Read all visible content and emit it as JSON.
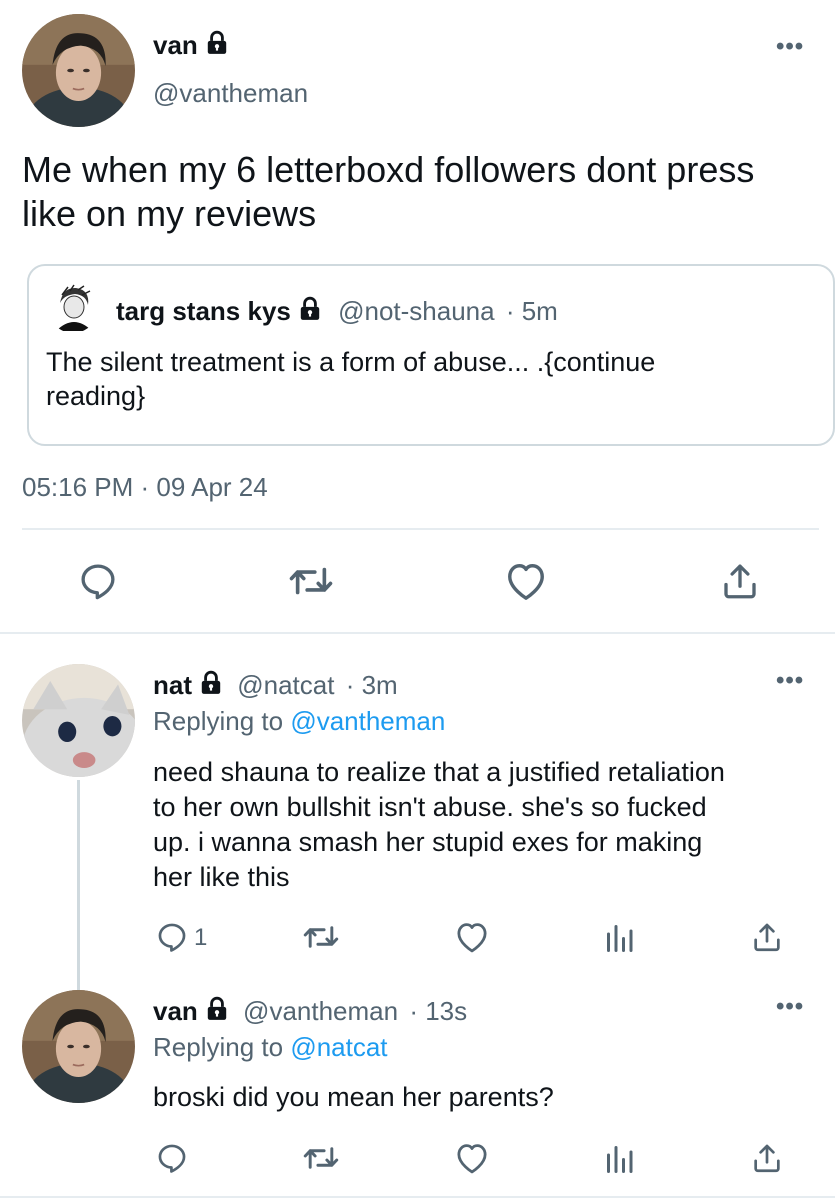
{
  "main_tweet": {
    "display_name": "van",
    "handle": "@vantheman",
    "text_line1": "Me when my 6 letterboxd followers dont press",
    "text_line2": "like on my reviews",
    "quoted": {
      "display_name": "targ stans kys",
      "handle": "@not-shauna",
      "time": "· 5m",
      "text_line1": "The silent treatment is a form of abuse... .{continue",
      "text_line2": "reading}"
    },
    "timestamp": "05:16 PM · 09 Apr 24",
    "more_icon": "more-horizontal-icon"
  },
  "replies": [
    {
      "display_name": "nat",
      "handle": "@natcat",
      "time": "· 3m",
      "replying_prefix": "Replying to",
      "replying_to": "@vantheman",
      "lines": [
        "need shauna to realize that a justified retaliation",
        "to her own bullshit isn't abuse. she's so fucked",
        "up. i wanna smash her stupid exes for making",
        "her like this"
      ],
      "reply_count": "1"
    },
    {
      "display_name": "van",
      "handle": "@vantheman",
      "time": "· 13s",
      "replying_prefix": "Replying to",
      "replying_to": "@natcat",
      "lines": [
        "broski did you mean her parents?"
      ],
      "reply_count": ""
    }
  ],
  "colors": {
    "text": "#0f1419",
    "muted": "#536471",
    "link": "#1d9bf0",
    "divider": "#e6ecf0"
  }
}
